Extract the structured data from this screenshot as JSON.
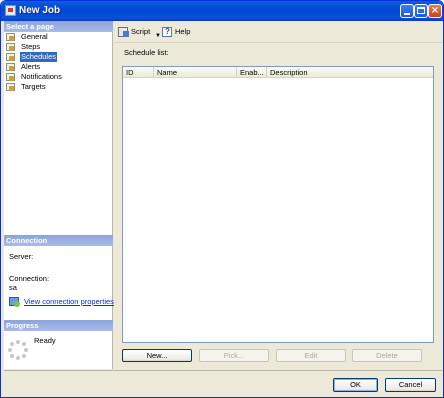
{
  "window": {
    "title": "New Job"
  },
  "left": {
    "select_page_header": "Select a page",
    "pages": [
      {
        "label": "General",
        "selected": false
      },
      {
        "label": "Steps",
        "selected": false
      },
      {
        "label": "Schedules",
        "selected": true
      },
      {
        "label": "Alerts",
        "selected": false
      },
      {
        "label": "Notifications",
        "selected": false
      },
      {
        "label": "Targets",
        "selected": false
      }
    ],
    "connection_header": "Connection",
    "server_label": "Server:",
    "connection_label": "Connection:",
    "connection_value": "sa",
    "view_connection_link": "View connection properties",
    "progress_header": "Progress",
    "progress_status": "Ready"
  },
  "toolbar": {
    "script_label": "Script",
    "help_label": "Help"
  },
  "schedule": {
    "list_label": "Schedule list:",
    "columns": [
      "ID",
      "Name",
      "Enab...",
      "Description"
    ],
    "rows": []
  },
  "buttons": {
    "new": "New...",
    "pick": "Pick...",
    "edit": "Edit",
    "delete": "Delete",
    "ok": "OK",
    "cancel": "Cancel"
  }
}
